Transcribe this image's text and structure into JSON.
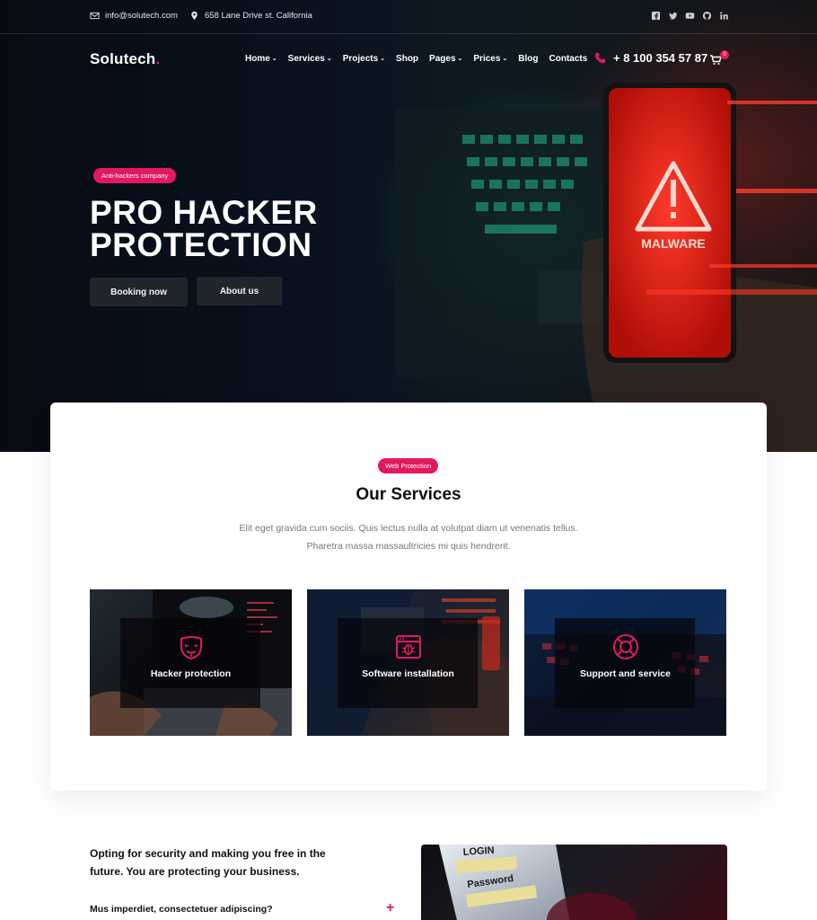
{
  "topbar": {
    "email": "info@solutech.com",
    "address": "658 Lane Drive st. California",
    "socials": [
      "facebook-icon",
      "twitter-icon",
      "youtube-icon",
      "github-icon",
      "linkedin-icon"
    ]
  },
  "header": {
    "logo": "Solutech",
    "logo_dot": ".",
    "nav": [
      {
        "label": "Home",
        "dropdown": true
      },
      {
        "label": "Services",
        "dropdown": true
      },
      {
        "label": "Projects",
        "dropdown": true
      },
      {
        "label": "Shop",
        "dropdown": false
      },
      {
        "label": "Pages",
        "dropdown": true
      },
      {
        "label": "Prices",
        "dropdown": true
      },
      {
        "label": "Blog",
        "dropdown": false
      },
      {
        "label": "Contacts",
        "dropdown": false
      }
    ],
    "phone": "+ 8 100 354 57 87",
    "cart_count": "0"
  },
  "hero": {
    "badge": "Anti-hackers company",
    "title_line1": "PRO HACKER",
    "title_line2": "PROTECTION",
    "button_primary": "Booking now",
    "button_secondary": "About us",
    "phone_screen_text": "MALWARE"
  },
  "services": {
    "badge": "Web Protection",
    "title": "Our Services",
    "desc_line1": "Elit eget gravida cum sociis. Quis lectus nulla at volutpat diam ut venenatis tellus.",
    "desc_line2": "Pharetra massa massaultricies mi quis hendrerit.",
    "items": [
      {
        "label": "Hacker protection",
        "icon": "mask-icon"
      },
      {
        "label": "Software installation",
        "icon": "bug-window-icon"
      },
      {
        "label": "Support and service",
        "icon": "lifebuoy-icon"
      }
    ]
  },
  "about": {
    "title": "Opting for security and making you free in the future. You are protecting your business.",
    "accordion_q1": "Mus imperdiet, consectetuer adipiscing?",
    "image_text_login": "LOGIN",
    "image_text_password": "Password"
  },
  "colors": {
    "accent": "#e2195f",
    "dark": "#21252c"
  }
}
